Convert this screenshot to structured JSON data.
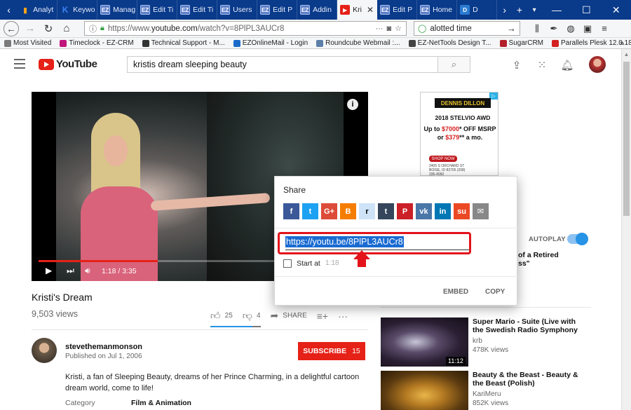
{
  "browser": {
    "tabs": [
      {
        "label": "Analyt",
        "icon": "analytics-icon"
      },
      {
        "label": "Keywo",
        "icon": "keyword-icon"
      },
      {
        "label": "Manag",
        "icon": "ez-icon"
      },
      {
        "label": "Edit Ti",
        "icon": "ez-icon"
      },
      {
        "label": "Edit Ti",
        "icon": "ez-icon"
      },
      {
        "label": "Users",
        "icon": "ez-icon"
      },
      {
        "label": "Edit P",
        "icon": "ez-icon"
      },
      {
        "label": "Addin",
        "icon": "ez-icon"
      },
      {
        "label": "Kri",
        "icon": "youtube-icon",
        "active": true
      },
      {
        "label": "Edit P",
        "icon": "ez-icon"
      },
      {
        "label": "Home",
        "icon": "ez-icon"
      },
      {
        "label": "D",
        "icon": "dd-icon"
      }
    ],
    "url_prefix": "https://www.",
    "url_domain": "youtube.com",
    "url_rest": "/watch?v=8PlPL3AUCr8",
    "search_value": "alotted time",
    "bookmarks": [
      {
        "label": "Most Visited",
        "color": "#7a7a7a"
      },
      {
        "label": "Timeclock - EZ-CRM",
        "color": "#c0167c"
      },
      {
        "label": "Technical Support - M...",
        "color": "#333333"
      },
      {
        "label": "EZOnlineMail - Login",
        "color": "#1b6ac9"
      },
      {
        "label": "Roundcube Webmail :...",
        "color": "#5b7fa8"
      },
      {
        "label": "EZ-NetTools Design T...",
        "color": "#444444"
      },
      {
        "label": "SugarCRM",
        "color": "#b3202a"
      },
      {
        "label": "Parallels Plesk 12.0.18",
        "color": "#d42020"
      }
    ]
  },
  "youtube": {
    "logo_text": "YouTube",
    "search_query": "kristis dream sleeping beauty",
    "video": {
      "current_time": "1:18",
      "duration": "3:35",
      "progress_pct": 37,
      "title": "Kristi's Dream",
      "views": "9,503 views",
      "likes": "25",
      "dislikes": "4",
      "share_label": "SHARE"
    },
    "channel": {
      "name": "stevethemanmonson",
      "published": "Published on Jul 1, 2006",
      "subscribe_label": "SUBSCRIBE",
      "subscriber_count": "15"
    },
    "description": "Kristi, a fan of Sleeping Beauty, dreams of her Prince Charming, in a delightful cartoon dream world, come to life!",
    "category_label": "Category",
    "category_value": "Film & Animation",
    "ad": {
      "brand": "DENNIS DILLON",
      "car": "2018 STELVIO AWD",
      "offer_line1_pre": "Up to ",
      "offer_line1_price": "$7000",
      "offer_line1_post": "* OFF MSRP",
      "offer_line2_pre": "or ",
      "offer_line2_price": "$379",
      "offer_line2_post": "** a mo.",
      "shop": "SHOP NOW",
      "address": "2405 S ORCHARD ST BOISE, ID 83705 (208) 336-4060"
    },
    "autoplay_label": "AUTOPLAY",
    "up_next_partial_line1": "of a Retired",
    "up_next_partial_line2": "ss\"",
    "recommendations": [
      {
        "title": "Super Mario - Suite (Live with the Swedish Radio Symphony",
        "channel": "krb",
        "views": "478K views",
        "duration": "11:12"
      },
      {
        "title": "Beauty & the Beast - Beauty & the Beast (Polish)",
        "channel": "KariMeru",
        "views": "852K views",
        "duration": ""
      }
    ]
  },
  "share_dialog": {
    "title": "Share",
    "link": "https://youtu.be/8PlPL3AUCr8",
    "start_at_label": "Start at",
    "start_at_time": "1:18",
    "embed_label": "EMBED",
    "copy_label": "COPY",
    "networks": [
      {
        "name": "facebook-icon",
        "glyph": "f",
        "color": "#3b5998"
      },
      {
        "name": "twitter-icon",
        "glyph": "t",
        "color": "#1da1f2"
      },
      {
        "name": "google-plus-icon",
        "glyph": "G+",
        "color": "#dd4b39"
      },
      {
        "name": "blogger-icon",
        "glyph": "B",
        "color": "#f57d00"
      },
      {
        "name": "reddit-icon",
        "glyph": "r",
        "color": "#cee3f8"
      },
      {
        "name": "tumblr-icon",
        "glyph": "t",
        "color": "#35465c"
      },
      {
        "name": "pinterest-icon",
        "glyph": "P",
        "color": "#cb2027"
      },
      {
        "name": "vk-icon",
        "glyph": "vk",
        "color": "#4a76a8"
      },
      {
        "name": "linkedin-icon",
        "glyph": "in",
        "color": "#0077b5"
      },
      {
        "name": "stumbleupon-icon",
        "glyph": "su",
        "color": "#eb4924"
      },
      {
        "name": "email-icon",
        "glyph": "✉",
        "color": "#888888"
      }
    ]
  }
}
